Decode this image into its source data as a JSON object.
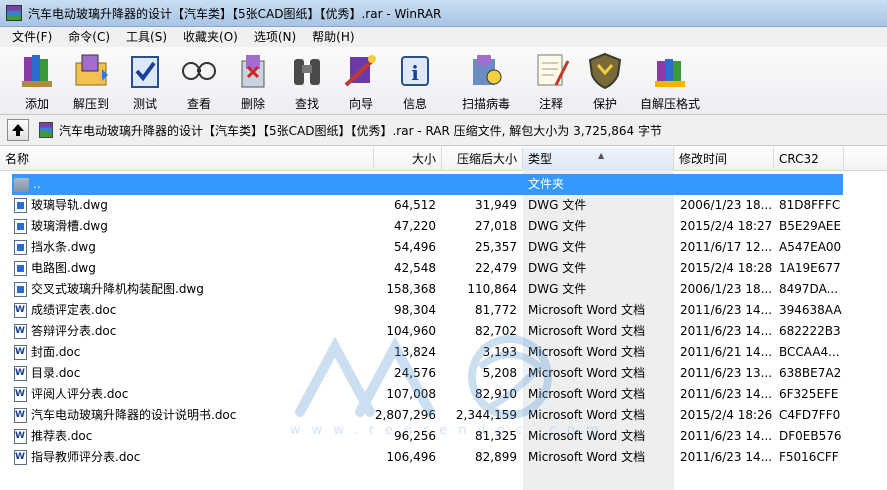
{
  "window": {
    "title": "汽车电动玻璃升降器的设计【汽车类】【5张CAD图纸】【优秀】.rar - WinRAR"
  },
  "menu": [
    "文件(F)",
    "命令(C)",
    "工具(S)",
    "收藏夹(O)",
    "选项(N)",
    "帮助(H)"
  ],
  "toolbar": [
    {
      "label": "添加",
      "icon": "books-add-icon"
    },
    {
      "label": "解压到",
      "icon": "extract-folder-icon"
    },
    {
      "label": "测试",
      "icon": "test-clipboard-icon"
    },
    {
      "label": "查看",
      "icon": "view-glasses-icon"
    },
    {
      "label": "删除",
      "icon": "delete-recycle-icon"
    },
    {
      "label": "查找",
      "icon": "find-binoculars-icon"
    },
    {
      "label": "向导",
      "icon": "wizard-wand-icon"
    },
    {
      "label": "信息",
      "icon": "info-icon"
    },
    {
      "label": "扫描病毒",
      "icon": "scan-virus-icon"
    },
    {
      "label": "注释",
      "icon": "comment-notepad-icon"
    },
    {
      "label": "保护",
      "icon": "protect-shield-icon"
    },
    {
      "label": "自解压格式",
      "icon": "sfx-archive-icon"
    }
  ],
  "address": {
    "text": "汽车电动玻璃升降器的设计【汽车类】【5张CAD图纸】【优秀】.rar - RAR 压缩文件, 解包大小为 3,725,864 字节"
  },
  "columns": {
    "name": "名称",
    "size": "大小",
    "packed": "压缩后大小",
    "type": "类型",
    "modified": "修改时间",
    "crc": "CRC32"
  },
  "watermark": {
    "text": "www.renrendoc.com"
  },
  "files": [
    {
      "name": "..",
      "size": "",
      "packed": "",
      "type": "文件夹",
      "modified": "",
      "crc": "",
      "kind": "folder"
    },
    {
      "name": "玻璃导轨.dwg",
      "size": "64,512",
      "packed": "31,949",
      "type": "DWG 文件",
      "modified": "2006/1/23 18...",
      "crc": "81D8FFFC",
      "kind": "dwg"
    },
    {
      "name": "玻璃滑槽.dwg",
      "size": "47,220",
      "packed": "27,018",
      "type": "DWG 文件",
      "modified": "2015/2/4 18:27",
      "crc": "B5E29AEE",
      "kind": "dwg"
    },
    {
      "name": "挡水条.dwg",
      "size": "54,496",
      "packed": "25,357",
      "type": "DWG 文件",
      "modified": "2011/6/17 12...",
      "crc": "A547EA00",
      "kind": "dwg"
    },
    {
      "name": "电路图.dwg",
      "size": "42,548",
      "packed": "22,479",
      "type": "DWG 文件",
      "modified": "2015/2/4 18:28",
      "crc": "1A19E677",
      "kind": "dwg"
    },
    {
      "name": "交叉式玻璃升降机构装配图.dwg",
      "size": "158,368",
      "packed": "110,864",
      "type": "DWG 文件",
      "modified": "2006/1/23 18...",
      "crc": "8497DA...",
      "kind": "dwg"
    },
    {
      "name": "成绩评定表.doc",
      "size": "98,304",
      "packed": "81,772",
      "type": "Microsoft Word 文档",
      "modified": "2011/6/23 14...",
      "crc": "394638AA",
      "kind": "doc"
    },
    {
      "name": "答辩评分表.doc",
      "size": "104,960",
      "packed": "82,702",
      "type": "Microsoft Word 文档",
      "modified": "2011/6/23 14...",
      "crc": "682222B3",
      "kind": "doc"
    },
    {
      "name": "封面.doc",
      "size": "13,824",
      "packed": "3,193",
      "type": "Microsoft Word 文档",
      "modified": "2011/6/21 14...",
      "crc": "BCCAA4...",
      "kind": "doc"
    },
    {
      "name": "目录.doc",
      "size": "24,576",
      "packed": "5,208",
      "type": "Microsoft Word 文档",
      "modified": "2011/6/23 13...",
      "crc": "638BE7A2",
      "kind": "doc"
    },
    {
      "name": "评阅人评分表.doc",
      "size": "107,008",
      "packed": "82,910",
      "type": "Microsoft Word 文档",
      "modified": "2011/6/23 14...",
      "crc": "6F325EFE",
      "kind": "doc"
    },
    {
      "name": "汽车电动玻璃升降器的设计说明书.doc",
      "size": "2,807,296",
      "packed": "2,344,159",
      "type": "Microsoft Word 文档",
      "modified": "2015/2/4 18:26",
      "crc": "C4FD7FF0",
      "kind": "doc"
    },
    {
      "name": "推荐表.doc",
      "size": "96,256",
      "packed": "81,325",
      "type": "Microsoft Word 文档",
      "modified": "2011/6/23 14...",
      "crc": "DF0EB576",
      "kind": "doc"
    },
    {
      "name": "指导教师评分表.doc",
      "size": "106,496",
      "packed": "82,899",
      "type": "Microsoft Word 文档",
      "modified": "2011/6/23 14...",
      "crc": "F5016CFF",
      "kind": "doc"
    }
  ]
}
